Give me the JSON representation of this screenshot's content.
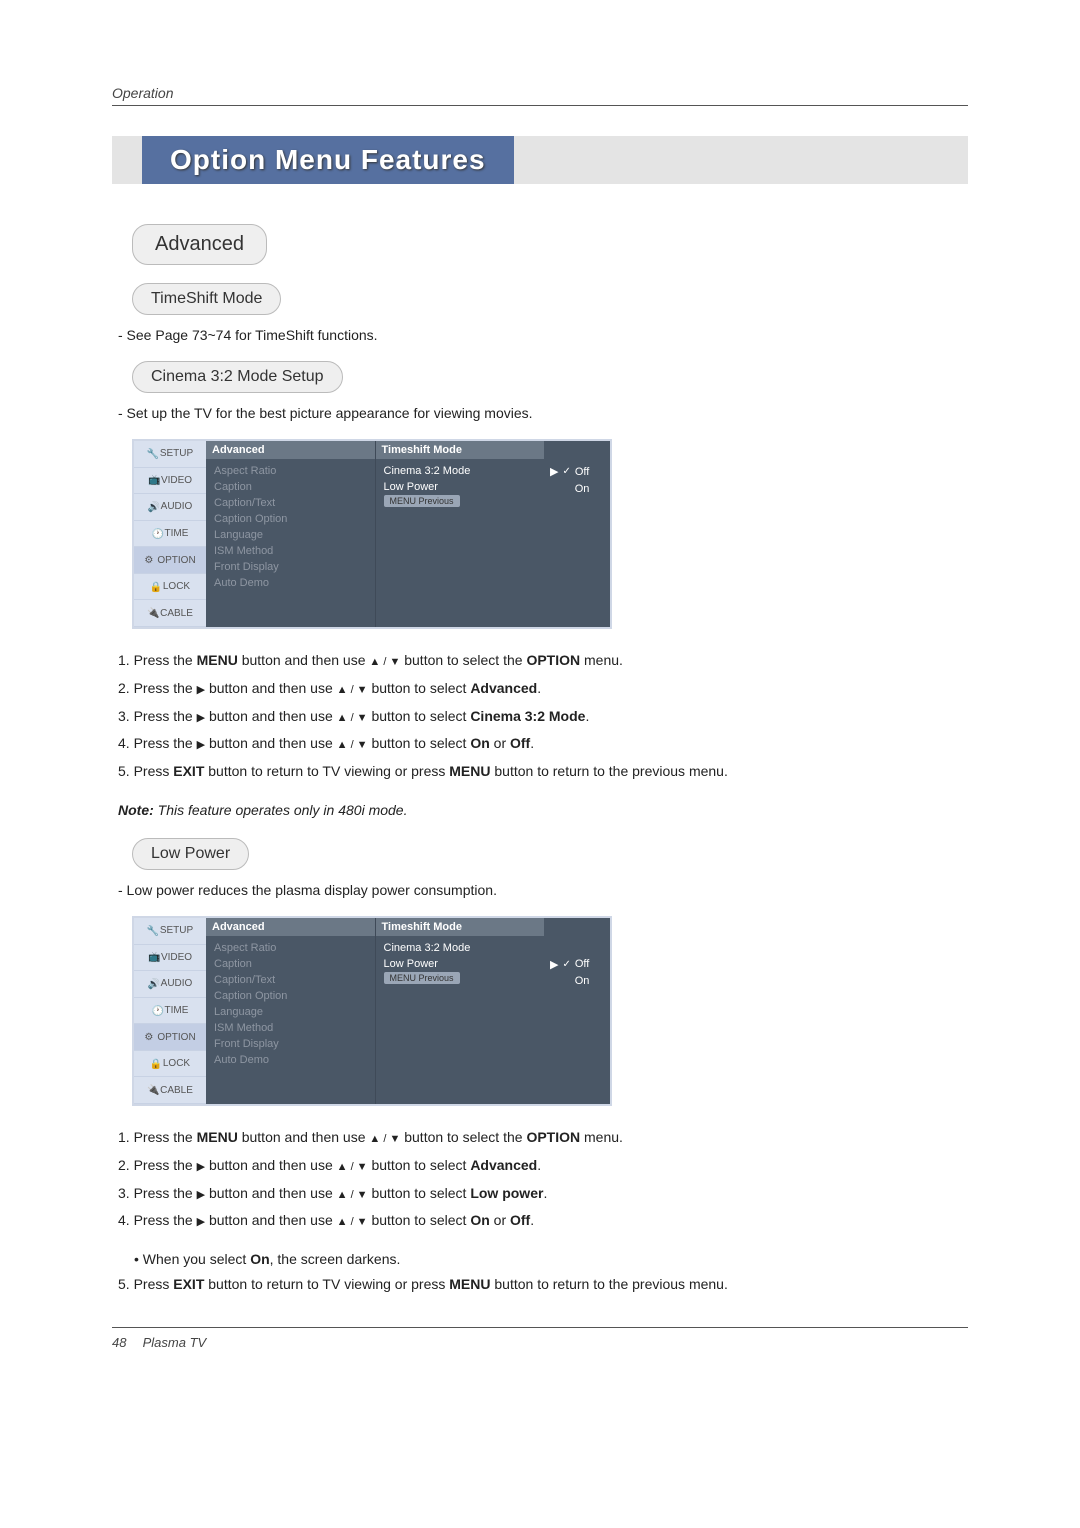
{
  "header": {
    "label": "Operation"
  },
  "title": "Option Menu Features",
  "advanced": {
    "heading": "Advanced"
  },
  "timeshift": {
    "heading": "TimeShift Mode",
    "desc": "-  See Page 73~74 for TimeShift functions."
  },
  "cinema": {
    "heading": "Cinema 3:2 Mode Setup",
    "desc": "-  Set up the TV for the best picture appearance for viewing movies.",
    "note_label": "Note:",
    "note_text": " This feature operates only in 480i mode."
  },
  "lowpower": {
    "heading": "Low Power",
    "desc": "-  Low power reduces the plasma display power consumption.",
    "bullet": "• When you select ",
    "bullet_bold": "On",
    "bullet_tail": ", the screen darkens."
  },
  "menu_sidebar": [
    "SETUP",
    "VIDEO",
    "AUDIO",
    "TIME",
    "OPTION",
    "LOCK",
    "CABLE"
  ],
  "menu_col1_head": "Advanced",
  "menu_col1_items": [
    "Aspect Ratio",
    "Caption",
    "Caption/Text",
    "Caption Option",
    "Language",
    "ISM Method",
    "Front Display",
    "Auto Demo"
  ],
  "menu_col2_items": [
    "Timeshift Mode",
    "Cinema 3:2 Mode",
    "Low Power"
  ],
  "menu_prev": "Previous",
  "vals_cinema": {
    "off": "Off",
    "on": "On",
    "check": "✓",
    "arrow": "▶"
  },
  "vals_low": {
    "off": "Off",
    "on": "On",
    "check": "✓",
    "arrow": "▶"
  },
  "steps_common": {
    "s1_a": "1. Press the ",
    "s1_b": "MENU",
    "s1_c": " button and then use ",
    "s1_tri": "▲ / ▼",
    "s1_d": " button to select the ",
    "s1_e": "OPTION",
    "s1_f": " menu.",
    "s2_a": "2. Press the ",
    "s2_tri1": "▶",
    "s2_b": " button and then use ",
    "s2_tri2": "▲ / ▼",
    "s2_c": " button to select ",
    "s2_d": "Advanced",
    "s2_e": ".",
    "s3_a": "3. Press the ",
    "s3_tri1": "▶",
    "s3_b": " button and then use ",
    "s3_tri2": "▲ / ▼",
    "s3_c": " button to select ",
    "s3_cinema": "Cinema 3:2 Mode",
    "s3_low": "Low power",
    "s3_e": ".",
    "s4_a": "4. Press the ",
    "s4_tri1": "▶",
    "s4_b": " button and then use ",
    "s4_tri2": "▲ / ▼",
    "s4_c": " button to select ",
    "s4_on": "On",
    "s4_or": " or ",
    "s4_off": "Off",
    "s4_e": ".",
    "s5_a": "5. Press ",
    "s5_b": "EXIT",
    "s5_c": " button to return to TV viewing or press ",
    "s5_d": "MENU",
    "s5_e": " button to return to the previous menu."
  },
  "footer": {
    "page": "48",
    "label": "Plasma TV"
  }
}
